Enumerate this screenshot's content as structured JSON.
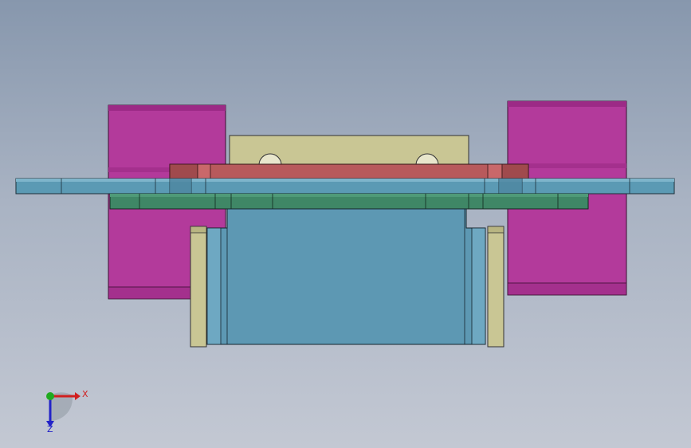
{
  "viewport": {
    "background_top": "#8797ad",
    "background_bottom": "#c3c8d3"
  },
  "model": {
    "parts": [
      {
        "name": "magenta-block",
        "color": "#b23a9a"
      },
      {
        "name": "khaki-bracket",
        "color": "#c9c694"
      },
      {
        "name": "red-plate",
        "color": "#b85a5c"
      },
      {
        "name": "blue-plate",
        "color": "#5b9ab4"
      },
      {
        "name": "green-plate",
        "color": "#3f8766"
      },
      {
        "name": "blue-body",
        "color": "#5d98b3"
      },
      {
        "name": "khaki-side-plate",
        "color": "#c9c694"
      }
    ]
  },
  "triad": {
    "x_label": "X",
    "z_label": "Z",
    "x_color": "#d11f1f",
    "y_color": "#1faa1f",
    "z_color": "#2222c8"
  }
}
